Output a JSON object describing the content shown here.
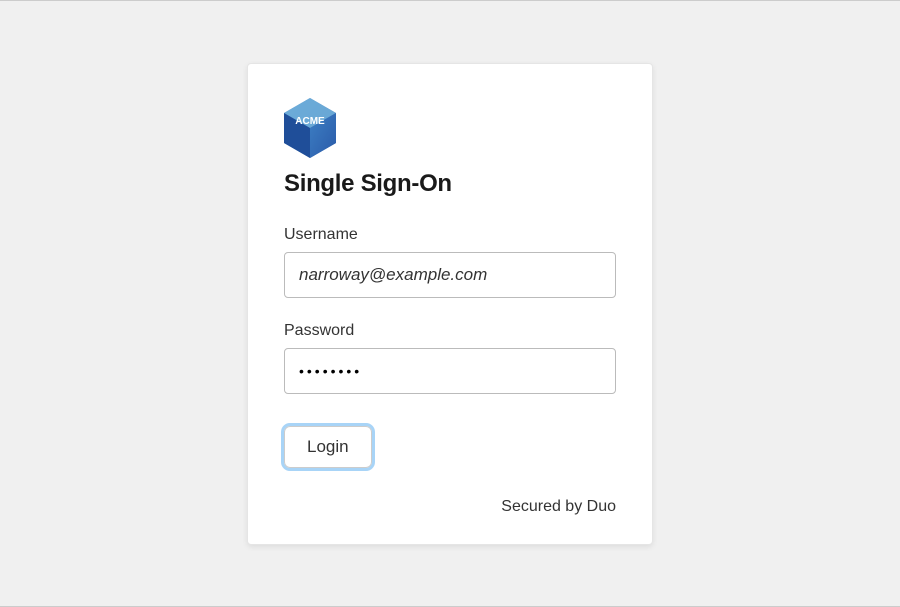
{
  "logo": {
    "name": "acme-logo",
    "text": "ACME"
  },
  "title": "Single Sign-On",
  "form": {
    "username": {
      "label": "Username",
      "value": "narroway@example.com"
    },
    "password": {
      "label": "Password",
      "value": "••••••••"
    },
    "submit_label": "Login"
  },
  "footer": {
    "secured_by": "Secured by Duo"
  }
}
